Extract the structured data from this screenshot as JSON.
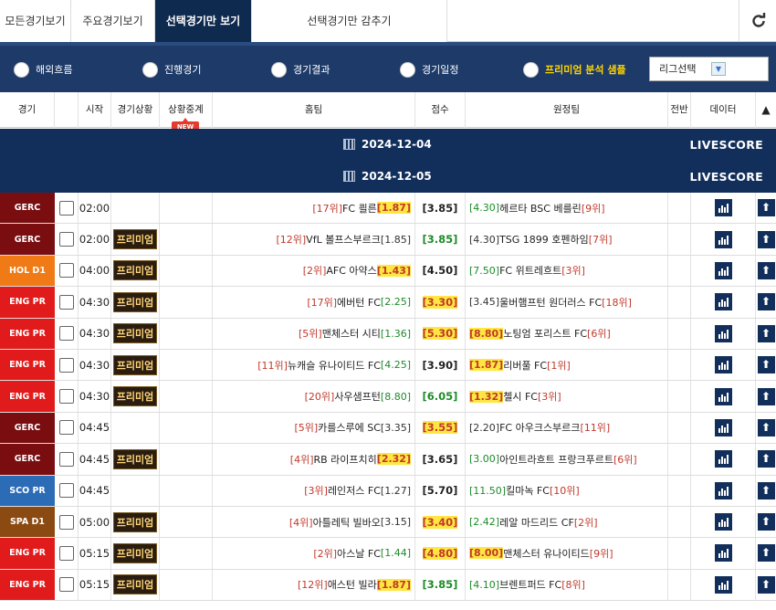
{
  "tabs": [
    {
      "label": "모든경기보기"
    },
    {
      "label": "주요경기보기"
    },
    {
      "label": "선택경기만 보기"
    },
    {
      "label": "선택경기만 감추기"
    }
  ],
  "filters": [
    {
      "label": "해외흐름"
    },
    {
      "label": "진행경기"
    },
    {
      "label": "경기결과"
    },
    {
      "label": "경기일정"
    },
    {
      "label": "프리미엄 분석 샘플"
    }
  ],
  "league_select": {
    "value": "리그선택"
  },
  "columns": [
    "경기",
    "시작",
    "경기상황",
    "상황중계",
    "홈팀",
    "점수",
    "원정팀",
    "전반",
    "데이터",
    "▲"
  ],
  "new_badge": "NEW",
  "date_bars": [
    {
      "date": "2024-12-04",
      "label": "LIVESCORE"
    },
    {
      "date": "2024-12-05",
      "label": "LIVESCORE"
    }
  ],
  "colors": {
    "accent": "#0f2a4f",
    "filterbar": "#1d3a68",
    "datebar": "#122f5c",
    "highlight": "#ffe640"
  },
  "premium_label": "프리미엄",
  "matches": [
    {
      "league": "GERC",
      "league_color": "#7a0d10",
      "time": "02:00",
      "premium": "",
      "home_rank": "[17위]",
      "home": "FC 쾰른",
      "home_odd": "[1.87]",
      "home_odd_style": "hl",
      "score": "[3.85]",
      "score_style": "sc-n",
      "away_odd": "[4.30]",
      "away_odd_style": "down",
      "away": "헤르타 BSC 베를린",
      "away_rank": "[9위]"
    },
    {
      "league": "GERC",
      "league_color": "#7a0d10",
      "time": "02:00",
      "premium": "프리미엄",
      "home_rank": "[12위]",
      "home": "VfL 볼프스부르크",
      "home_odd": "[1.85]",
      "home_odd_style": "",
      "score": "[3.85]",
      "score_style": "sc-g",
      "away_odd": "[4.30]",
      "away_odd_style": "",
      "away": "TSG 1899 호펜하임",
      "away_rank": "[7위]"
    },
    {
      "league": "HOL D1",
      "league_color": "#f07a16",
      "time": "04:00",
      "premium": "프리미엄",
      "home_rank": "[2위]",
      "home": "AFC 아약스",
      "home_odd": "[1.43]",
      "home_odd_style": "hl",
      "score": "[4.50]",
      "score_style": "sc-n",
      "away_odd": "[7.50]",
      "away_odd_style": "down",
      "away": "FC 위트레흐트",
      "away_rank": "[3위]"
    },
    {
      "league": "ENG PR",
      "league_color": "#e11b1b",
      "time": "04:30",
      "premium": "프리미엄",
      "home_rank": "[17위]",
      "home": "에버턴 FC",
      "home_odd": "[2.25]",
      "home_odd_style": "down",
      "score": "[3.30]",
      "score_style": "sc-y",
      "away_odd": "[3.45]",
      "away_odd_style": "",
      "away": "울버햄프턴 원더러스 FC",
      "away_rank": "[18위]"
    },
    {
      "league": "ENG PR",
      "league_color": "#e11b1b",
      "time": "04:30",
      "premium": "프리미엄",
      "home_rank": "[5위]",
      "home": "맨체스터 시티",
      "home_odd": "[1.36]",
      "home_odd_style": "down",
      "score": "[5.30]",
      "score_style": "sc-y",
      "away_odd": "[8.80]",
      "away_odd_style": "hl",
      "away": "노팅엄 포리스트 FC",
      "away_rank": "[6위]"
    },
    {
      "league": "ENG PR",
      "league_color": "#e11b1b",
      "time": "04:30",
      "premium": "프리미엄",
      "home_rank": "[11위]",
      "home": "뉴캐슬 유나이티드 FC",
      "home_odd": "[4.25]",
      "home_odd_style": "down",
      "score": "[3.90]",
      "score_style": "sc-n",
      "away_odd": "[1.87]",
      "away_odd_style": "hl",
      "away": "리버풀 FC",
      "away_rank": "[1위]"
    },
    {
      "league": "ENG PR",
      "league_color": "#e11b1b",
      "time": "04:30",
      "premium": "프리미엄",
      "home_rank": "[20위]",
      "home": "사우샘프턴",
      "home_odd": "[8.80]",
      "home_odd_style": "down",
      "score": "[6.05]",
      "score_style": "sc-g",
      "away_odd": "[1.32]",
      "away_odd_style": "hl",
      "away": "첼시 FC",
      "away_rank": "[3위]"
    },
    {
      "league": "GERC",
      "league_color": "#7a0d10",
      "time": "04:45",
      "premium": "",
      "home_rank": "[5위]",
      "home": "카를스루에 SC",
      "home_odd": "[3.35]",
      "home_odd_style": "",
      "score": "[3.55]",
      "score_style": "sc-y",
      "away_odd": "[2.20]",
      "away_odd_style": "",
      "away": "FC 아우크스부르크",
      "away_rank": "[11위]"
    },
    {
      "league": "GERC",
      "league_color": "#7a0d10",
      "time": "04:45",
      "premium": "프리미엄",
      "home_rank": "[4위]",
      "home": "RB 라이프치히",
      "home_odd": "[2.32]",
      "home_odd_style": "hl",
      "score": "[3.65]",
      "score_style": "sc-n",
      "away_odd": "[3.00]",
      "away_odd_style": "down",
      "away": "아인트라흐트 프랑크푸르트",
      "away_rank": "[6위]"
    },
    {
      "league": "SCO PR",
      "league_color": "#2c6bb5",
      "time": "04:45",
      "premium": "",
      "home_rank": "[3위]",
      "home": "레인저스 FC",
      "home_odd": "[1.27]",
      "home_odd_style": "",
      "score": "[5.70]",
      "score_style": "sc-n",
      "away_odd": "[11.50]",
      "away_odd_style": "down",
      "away": "킬마녹 FC",
      "away_rank": "[10위]"
    },
    {
      "league": "SPA D1",
      "league_color": "#8c4a13",
      "time": "05:00",
      "premium": "프리미엄",
      "home_rank": "[4위]",
      "home": "아틀레틱 빌바오",
      "home_odd": "[3.15]",
      "home_odd_style": "",
      "score": "[3.40]",
      "score_style": "sc-y",
      "away_odd": "[2.42]",
      "away_odd_style": "down",
      "away": "레알 마드리드 CF",
      "away_rank": "[2위]"
    },
    {
      "league": "ENG PR",
      "league_color": "#e11b1b",
      "time": "05:15",
      "premium": "프리미엄",
      "home_rank": "[2위]",
      "home": "아스날 FC",
      "home_odd": "[1.44]",
      "home_odd_style": "down",
      "score": "[4.80]",
      "score_style": "sc-y",
      "away_odd": "[8.00]",
      "away_odd_style": "hl",
      "away": "맨체스터 유나이티드",
      "away_rank": "[9위]"
    },
    {
      "league": "ENG PR",
      "league_color": "#e11b1b",
      "time": "05:15",
      "premium": "프리미엄",
      "home_rank": "[12위]",
      "home": "애스턴 빌라",
      "home_odd": "[1.87]",
      "home_odd_style": "hl",
      "score": "[3.85]",
      "score_style": "sc-g",
      "away_odd": "[4.10]",
      "away_odd_style": "down",
      "away": "브렌트퍼드 FC",
      "away_rank": "[8위]"
    }
  ]
}
